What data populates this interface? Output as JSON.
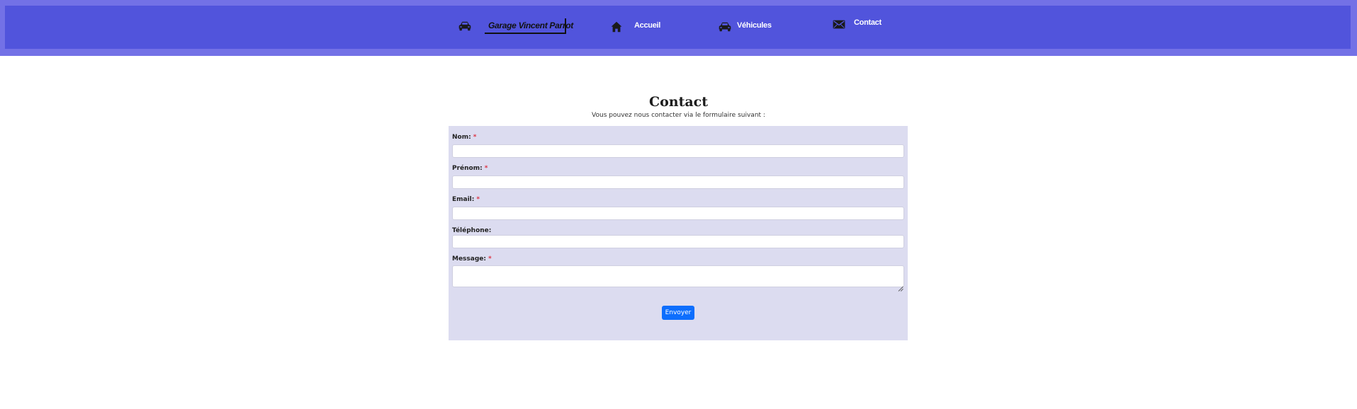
{
  "header": {
    "brand": "Garage Vincent Parrot",
    "nav": {
      "home": "Accueil",
      "vehicles": "Véhicules",
      "contact": "Contact"
    },
    "colors": {
      "outer": "#7371e6",
      "inner": "#5154dc"
    },
    "icons": {
      "brand": "car-icon",
      "home": "house-icon",
      "vehicles": "car-icon",
      "contact": "envelope-icon"
    }
  },
  "main": {
    "title": "Contact",
    "subtitle": "Vous pouvez nous contacter via le formulaire suivant :",
    "form": {
      "fields": [
        {
          "label": "Nom:",
          "required": true,
          "value": ""
        },
        {
          "label": "Prénom:",
          "required": true,
          "value": ""
        },
        {
          "label": "Email:",
          "required": true,
          "value": ""
        },
        {
          "label": "Téléphone:",
          "required": false,
          "value": ""
        },
        {
          "label": "Message:",
          "required": true,
          "value": ""
        }
      ],
      "required_marker": "*",
      "submit": "Envoyer",
      "panel_color": "#dcdcf0",
      "button_color": "#0d6efd"
    }
  }
}
